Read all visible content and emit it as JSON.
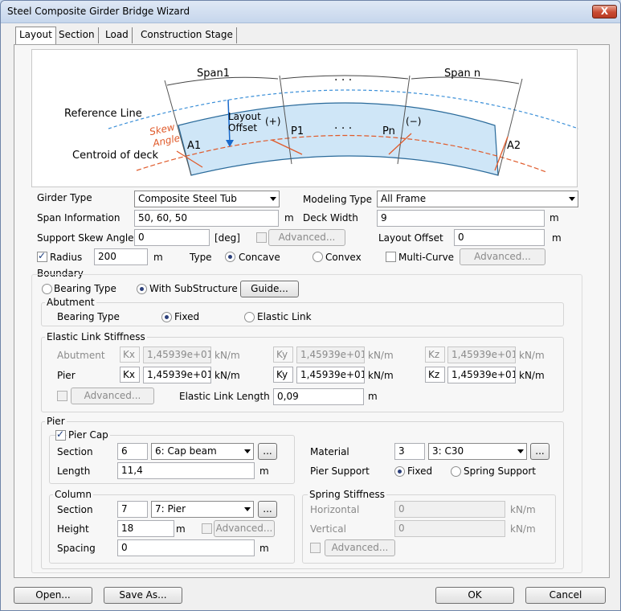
{
  "window": {
    "title": "Steel Composite Girder Bridge Wizard",
    "close": "X"
  },
  "tabs": [
    "Layout",
    "Section",
    "Load",
    "Construction Stage"
  ],
  "diagram": {
    "span1": "Span1",
    "dots": "· · ·",
    "spann": "Span n",
    "ref_line": "Reference Line",
    "layout_offset_1": "Layout",
    "layout_offset_2": "Offset",
    "plus": "(+)",
    "minus": "(−)",
    "p1": "P1",
    "pn": "Pn",
    "skew1": "Skew",
    "skew2": "Angle",
    "a1": "A1",
    "a2": "A2",
    "centroid": "Centroid of deck"
  },
  "layout": {
    "girder_type_label": "Girder Type",
    "girder_type": "Composite Steel Tub",
    "modeling_type_label": "Modeling Type",
    "modeling_type": "All Frame",
    "span_info_label": "Span Information",
    "span_info": "50, 60, 50",
    "span_unit": "m",
    "deck_width_label": "Deck Width",
    "deck_width": "9",
    "deck_unit": "m",
    "skew_label": "Support Skew Angle",
    "skew": "0",
    "skew_unit": "[deg]",
    "advanced": "Advanced...",
    "layout_offset_label": "Layout Offset",
    "layout_offset": "0",
    "layout_offset_unit": "m",
    "radius_label": "Radius",
    "radius": "200",
    "radius_unit": "m",
    "type_label": "Type",
    "concave": "Concave",
    "convex": "Convex",
    "multicurve": "Multi-Curve"
  },
  "boundary": {
    "title": "Boundary",
    "bearing_type": "Bearing Type",
    "with_sub": "With SubStructure",
    "guide": "Guide...",
    "abutment_title": "Abutment",
    "abut_bearing_type": "Bearing Type",
    "fixed": "Fixed",
    "elastic_link": "Elastic Link",
    "elastic_title": "Elastic Link Stiffness",
    "abutment": "Abutment",
    "pier": "Pier",
    "kx": "Kx",
    "ky": "Ky",
    "kz": "Kz",
    "kval": "1,45939e+011",
    "kunit": "kN/m",
    "advanced": "Advanced...",
    "elastic_len_label": "Elastic Link Length",
    "elastic_len": "0,09",
    "elastic_len_unit": "m"
  },
  "pier": {
    "title": "Pier",
    "pier_cap": "Pier Cap",
    "section_label": "Section",
    "section_id": "6",
    "section_name": "6: Cap beam",
    "more": "...",
    "length_label": "Length",
    "length": "11,4",
    "length_unit": "m",
    "material_label": "Material",
    "material_id": "3",
    "material_name": "3: C30",
    "pier_support_label": "Pier Support",
    "fixed": "Fixed",
    "spring_support": "Spring Support",
    "column_title": "Column",
    "col_section_id": "7",
    "col_section_name": "7: Pier",
    "height_label": "Height",
    "height": "18",
    "height_unit": "m",
    "advanced": "Advanced...",
    "spacing_label": "Spacing",
    "spacing": "0",
    "spacing_unit": "m",
    "spring_title": "Spring Stiffness",
    "horizontal": "Horizontal",
    "vertical": "Vertical",
    "h_val": "0",
    "v_val": "0",
    "s_unit": "kN/m"
  },
  "footer": {
    "open": "Open...",
    "save_as": "Save As...",
    "ok": "OK",
    "cancel": "Cancel"
  }
}
